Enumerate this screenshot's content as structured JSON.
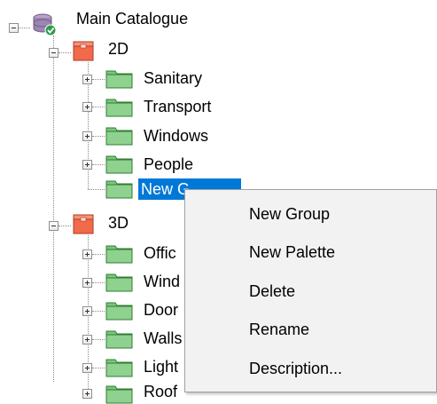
{
  "tree": {
    "root": {
      "label": "Main Catalogue",
      "icon": "database-icon"
    },
    "group_2d": {
      "label": "2D",
      "icon": "red-box-icon",
      "children": [
        {
          "label": "Sanitary"
        },
        {
          "label": "Transport"
        },
        {
          "label": "Windows"
        },
        {
          "label": "People"
        },
        {
          "label": "New G"
        }
      ]
    },
    "group_3d": {
      "label": "3D",
      "icon": "red-box-icon",
      "children": [
        {
          "label": "Offic"
        },
        {
          "label": "Wind"
        },
        {
          "label": "Door"
        },
        {
          "label": "Walls"
        },
        {
          "label": "Light"
        },
        {
          "label": "Roof"
        }
      ]
    }
  },
  "context_menu": {
    "items": [
      {
        "label": "New Group"
      },
      {
        "label": "New Palette"
      },
      {
        "label": "Delete"
      },
      {
        "label": "Rename"
      },
      {
        "label": "Description..."
      }
    ]
  },
  "colors": {
    "selection": "#0078d7",
    "folder_green": "#5cb85c",
    "box_red": "#e8553a",
    "menu_bg": "#f2f2f2"
  }
}
